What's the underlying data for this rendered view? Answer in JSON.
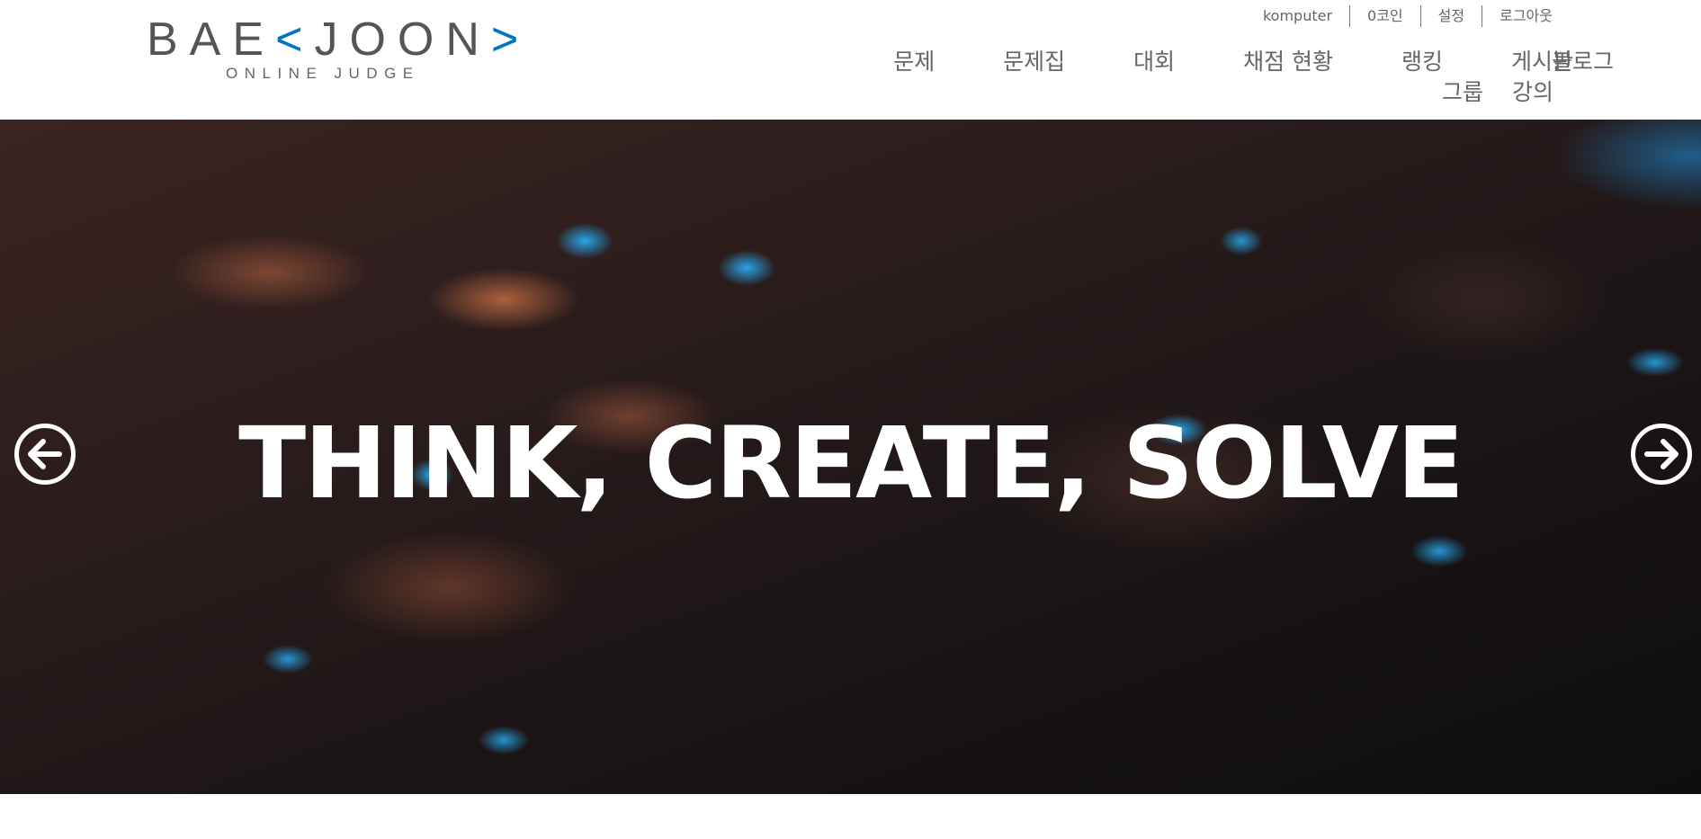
{
  "logo": {
    "main_prefix": "BAE",
    "main_accent_left": "<",
    "main_middle": "JOON",
    "main_accent_right": ">",
    "sub": "ONLINE JUDGE",
    "accent_color": "#0076C0"
  },
  "util_bar": {
    "username": "komputer",
    "coins": "0코인",
    "settings": "설정",
    "logout": "로그아웃"
  },
  "nav": {
    "items": [
      {
        "label": "문제"
      },
      {
        "label": "문제집"
      },
      {
        "label": "대회"
      },
      {
        "label": "채점 현황"
      },
      {
        "label": "랭킹"
      },
      {
        "label": "게시판"
      },
      {
        "label": "그룹"
      },
      {
        "label": "블로그"
      },
      {
        "label": "강의"
      }
    ]
  },
  "hero": {
    "title": "THINK, CREATE, SOLVE",
    "prev_icon": "arrow-left-circle-icon",
    "next_icon": "arrow-right-circle-icon"
  }
}
